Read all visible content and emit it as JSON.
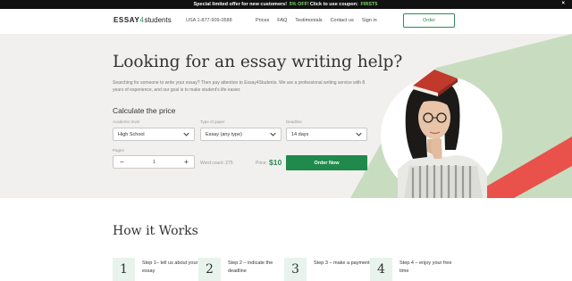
{
  "promo": {
    "text_before": "Special limited offer for new customers!",
    "discount": "5% OFF!",
    "text_after": "Click to use coupon:",
    "coupon": "FIRST5",
    "close": "×"
  },
  "header": {
    "logo_main": "ESSAY",
    "logo_num": "4",
    "logo_tail": "students",
    "phone": "USA 1-877-909-0588",
    "nav": [
      "Prices",
      "FAQ",
      "Testimonials",
      "Contact us",
      "Sign in"
    ],
    "order_button": "Order"
  },
  "hero": {
    "title": "Looking for an essay writing help?",
    "description": "Searching for someone to write your essay? Then pay attention to Essay4Students. We are a professional writing service with 8 years of experience, and our goal is to make student's life easier.",
    "calc_title": "Calculate the price",
    "fields": {
      "academic_level": {
        "label": "Academic level",
        "value": "High School"
      },
      "type_of_paper": {
        "label": "Type of paper",
        "value": "Essay (any type)"
      },
      "deadline": {
        "label": "Deadline",
        "value": "14 days"
      },
      "pages": {
        "label": "Pages",
        "value": "1",
        "minus": "−",
        "plus": "+"
      }
    },
    "word_count": "Word count: 275",
    "price_label": "Price:",
    "price_value": "$10",
    "order_now": "Order Now"
  },
  "how": {
    "title": "How it Works",
    "steps": [
      {
        "num": "1",
        "text": "Step 1– tell us about your essay"
      },
      {
        "num": "2",
        "text": "Step 2 – indicate the deadline"
      },
      {
        "num": "3",
        "text": "Step 3 – make a payment"
      },
      {
        "num": "4",
        "text": "Step 4 – enjoy your free time"
      }
    ]
  },
  "colors": {
    "brand_green": "#1f8a4c",
    "accent_red": "#e8524a",
    "shape_green": "#c8dcc0",
    "hero_bg": "#f1f0ee"
  }
}
